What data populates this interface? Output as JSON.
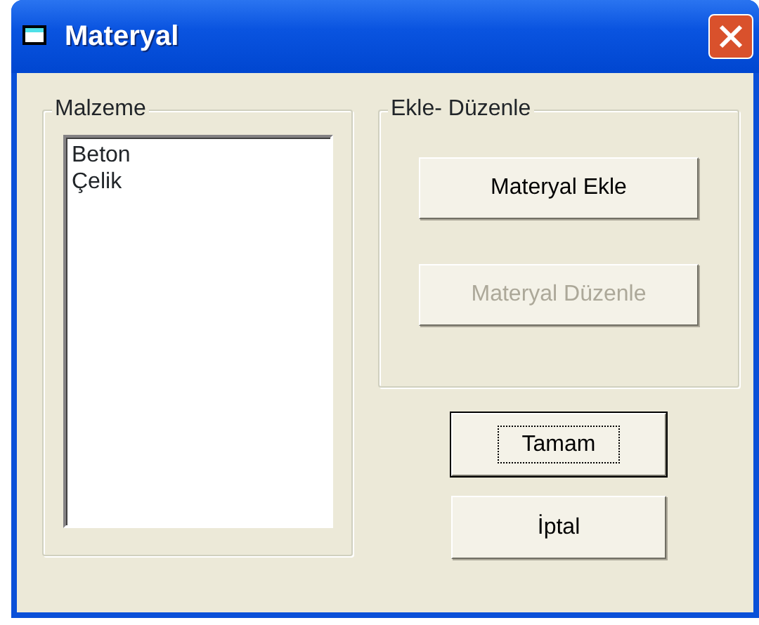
{
  "window": {
    "title": "Materyal"
  },
  "material_group": {
    "title": "Malzeme",
    "items": [
      {
        "label": "Beton",
        "selected": false
      },
      {
        "label": "Çelik",
        "selected": false
      }
    ]
  },
  "edit_group": {
    "title": "Ekle- Düzenle",
    "buttons": [
      {
        "label": "Materyal Ekle",
        "disabled": false
      },
      {
        "label": "Materyal Düzenle",
        "disabled": true
      }
    ]
  },
  "buttons": [
    {
      "label": "Tamam",
      "default": true
    },
    {
      "label": "İptal",
      "default": false
    }
  ]
}
